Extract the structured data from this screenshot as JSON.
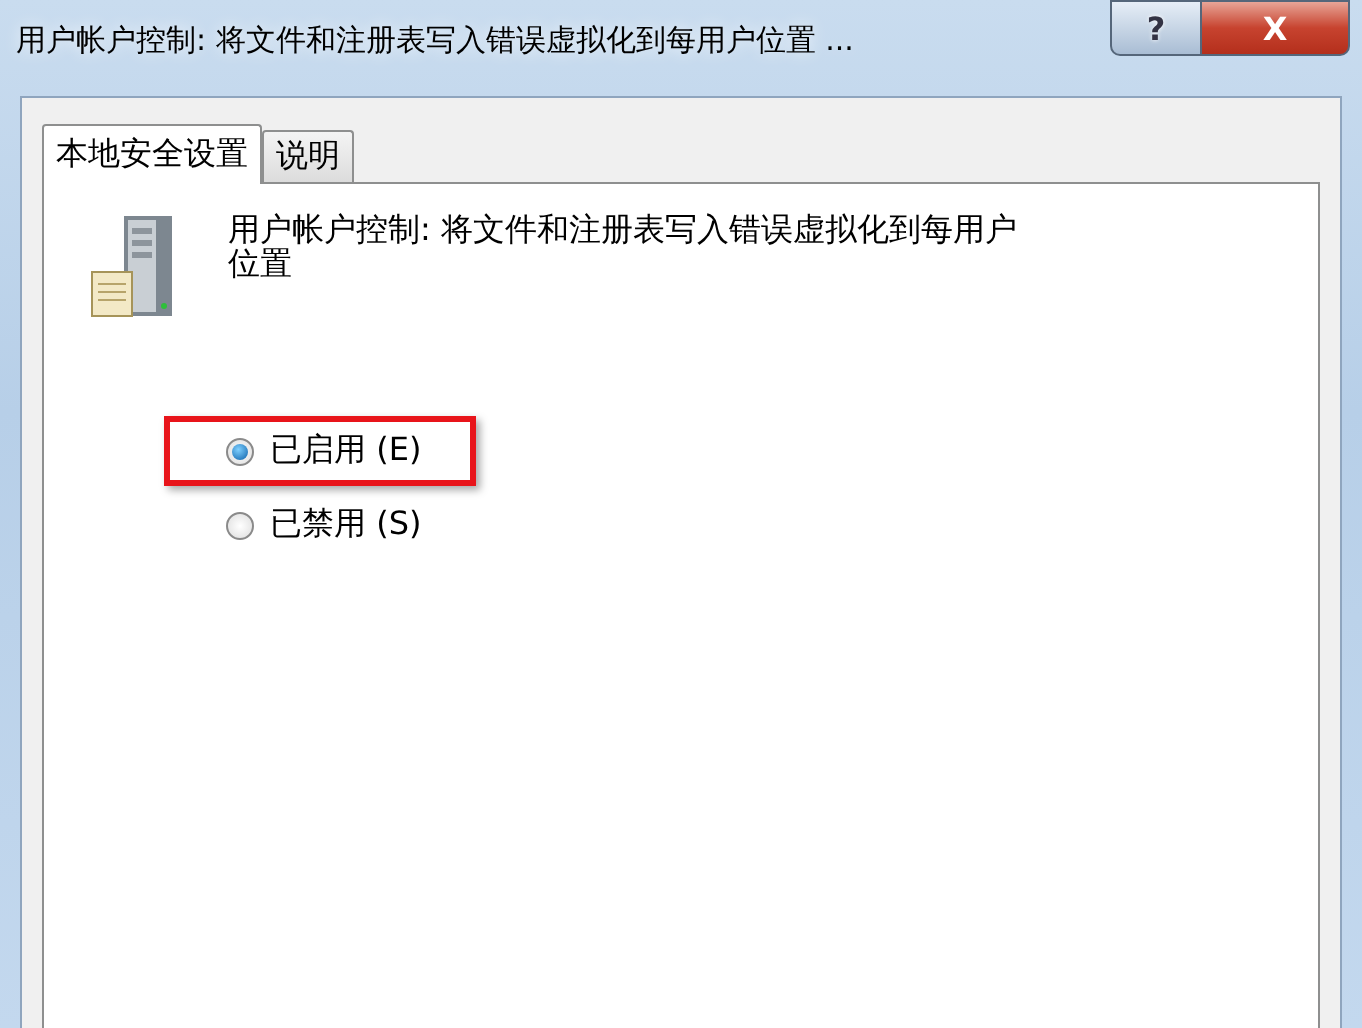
{
  "window": {
    "title": "用户帐户控制: 将文件和注册表写入错误虚拟化到每用户位置 ...",
    "help_button": "?",
    "close_button": "X"
  },
  "tabs": [
    {
      "label": "本地安全设置",
      "selected": true
    },
    {
      "label": "说明",
      "selected": false
    }
  ],
  "policy": {
    "name": "用户帐户控制: 将文件和注册表写入错误虚拟化到每用户位置"
  },
  "options": [
    {
      "label": "已启用 (E)",
      "selected": true,
      "highlighted": true
    },
    {
      "label": "已禁用 (S)",
      "selected": false,
      "highlighted": false
    }
  ]
}
